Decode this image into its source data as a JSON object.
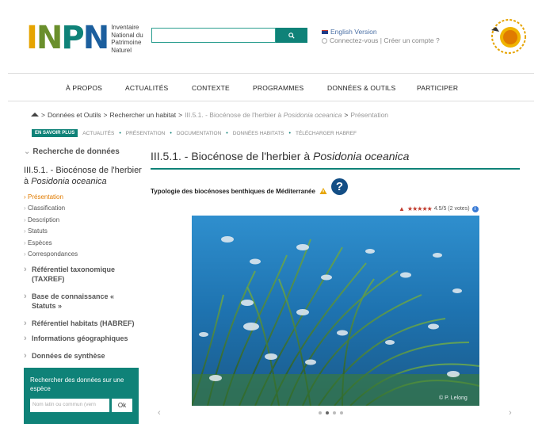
{
  "header": {
    "logo_letters": [
      "I",
      "N",
      "P",
      "N"
    ],
    "logo_lines": [
      "Inventaire",
      "National du",
      "Patrimoine",
      "Naturel"
    ],
    "search_placeholder": "",
    "search_icon": "search-icon",
    "lang_link": "English Version",
    "account": "Connectez-vous | Créer un compte ?",
    "badge_icon": "biodiversity-badge-icon"
  },
  "nav": {
    "items": [
      "À PROPOS",
      "ACTUALITÉS",
      "CONTEXTE",
      "PROGRAMMES",
      "DONNÉES & OUTILS",
      "PARTICIPER"
    ]
  },
  "breadcrumb": {
    "home_icon": "home-icon",
    "part1": "Données et Outils",
    "part2": "Rechercher un habitat",
    "part3_prefix": "III.5.1. - Biocénose de l'herbier à ",
    "part3_italic": "Posidonia oceanica",
    "part4": "Présentation"
  },
  "subnav": {
    "savoir": "EN SAVOIR PLUS",
    "links": [
      "ACTUALITÉS",
      "PRÉSENTATION",
      "DOCUMENTATION",
      "DONNÉES HABITATS",
      "TÉLÉCHARGER HABREF"
    ]
  },
  "sidebar": {
    "heading": "Recherche de données",
    "title_prefix": "III.5.1. - Biocénose de l'herbier à ",
    "title_italic": "Posidonia oceanica",
    "items": [
      "Présentation",
      "Classification",
      "Description",
      "Statuts",
      "Espèces",
      "Correspondances"
    ],
    "sections": [
      "Référentiel taxonomique (TAXREF)",
      "Base de connaissance « Statuts »",
      "Référentiel habitats (HABREF)",
      "Informations géographiques",
      "Données de synthèse"
    ],
    "search_label": "Rechercher des données sur une espèce",
    "search_placeholder": "Nom latin ou commun (vern",
    "search_ok": "Ok"
  },
  "main": {
    "title_prefix": "III.5.1. - Biocénose de l'herbier à ",
    "title_italic": "Posidonia oceanica",
    "typology": "Typologie des biocénoses benthiques de Méditerranée",
    "help_icon": "help-icon",
    "rating_text": "4.5/5 (2 votes)",
    "rating_value": 4.5,
    "photo_credit": "© P. Lelong",
    "carousel_dots": 4,
    "carousel_active": 1
  },
  "colors": {
    "accent": "#0f8278",
    "rule": "#0f8278",
    "active": "#e07b00",
    "help": "#134e85"
  }
}
